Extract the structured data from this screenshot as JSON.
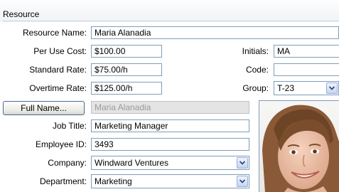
{
  "section": {
    "title": "Resource"
  },
  "fields": {
    "resource_name": {
      "label": "Resource Name:",
      "value": "Maria Alanadia"
    },
    "per_use_cost": {
      "label": "Per Use Cost:",
      "value": "$100.00"
    },
    "standard_rate": {
      "label": "Standard Rate:",
      "value": "$75.00/h"
    },
    "overtime_rate": {
      "label": "Overtime Rate:",
      "value": "$125.00/h"
    },
    "initials": {
      "label": "Initials:",
      "value": "MA"
    },
    "code": {
      "label": "Code:",
      "value": ""
    },
    "group": {
      "label": "Group:",
      "value": "T-23"
    },
    "full_name": {
      "button": "Full Name...",
      "value": "Maria Alanadia"
    },
    "job_title": {
      "label": "Job Title:",
      "value": "Marketing Manager"
    },
    "employee_id": {
      "label": "Employee ID:",
      "value": "3493"
    },
    "company": {
      "label": "Company:",
      "value": "Windward Ventures"
    },
    "department": {
      "label": "Department:",
      "value": "Marketing"
    }
  },
  "icons": {
    "dropdown": "chevron-down-icon",
    "photo": "employee-photo"
  }
}
